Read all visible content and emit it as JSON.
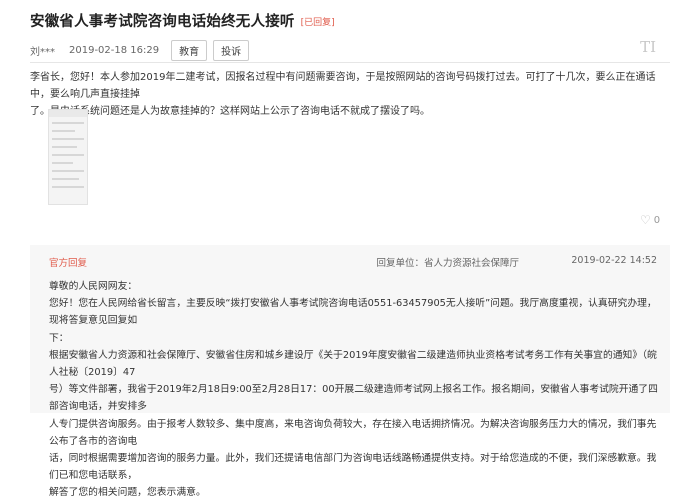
{
  "post": {
    "title": "安徽省人事考试院咨询电话始终无人接听",
    "status": "[已回复]",
    "author": "刘***",
    "date": "2019-02-18 16:29",
    "tags": [
      "教育",
      "投诉"
    ],
    "font_toggle": "TI",
    "body_line1": "李省长，您好！本人参加2019年二建考试，因报名过程中有问题需要咨询，于是按照网站的咨询号码拨打过去。可打了十几次，要么正在通话中，要么响几声直接挂掉",
    "body_line2": "了。是电话系统问题还是人为故意挂掉的？这样网站上公示了咨询电话不就成了摆设了吗。",
    "like_count": "0"
  },
  "reply": {
    "label": "官方回复",
    "unit": "回复单位：省人力资源社会保障厅",
    "date": "2019-02-22 14:52",
    "greeting": "尊敬的人民网网友：",
    "line1": "您好！您在人民网给省长留言，主要反映“拨打安徽省人事考试院咨询电话0551-63457905无人接听”问题。我厅高度重视，认真研究办理，现将答复意见回复如",
    "line2": "下：",
    "line3": "根据安徽省人力资源和社会保障厅、安徽省住房和城乡建设厅《关于2019年度安徽省二级建造师执业资格考试考务工作有关事宜的通知》（皖人社秘〔2019〕47",
    "line4": "号）等文件部署，我省于2019年2月18日9:00至2月28日17：00开展二级建造师考试网上报名工作。报名期间，安徽省人事考试院开通了四部咨询电话，并安排多",
    "line5": "人专门提供咨询服务。由于报考人数较多、集中度高，来电咨询负荷较大，存在接入电话拥挤情况。为解决咨询服务压力大的情况，我们事先公布了各市的咨询电",
    "line6": "话，同时根据需要增加咨询的服务力量。此外，我们还提请电信部门为咨询电话线路畅通提供支持。对于给您造成的不便，我们深感歉意。我们已和您电话联系，",
    "line7": "解答了您的相关问题，您表示满意。"
  }
}
